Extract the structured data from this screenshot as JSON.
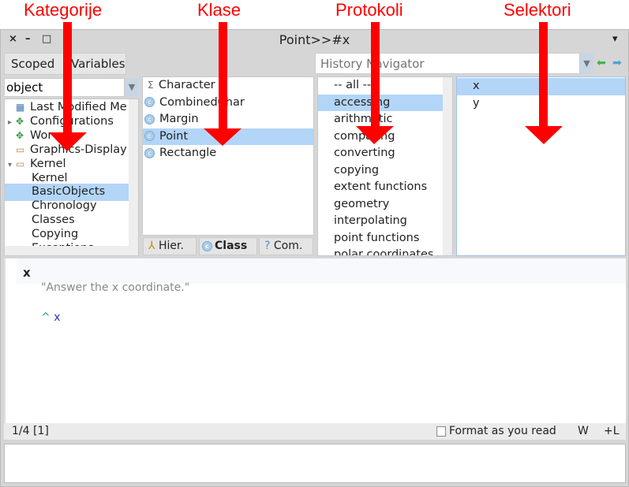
{
  "annotations": [
    "Kategorije",
    "Klase",
    "Protokoli",
    "Selektori"
  ],
  "window": {
    "title": "Point>>#x",
    "close": "×",
    "minimize": "–",
    "maximize": "□",
    "menu": "▾"
  },
  "toolbar": {
    "scoped": "Scoped",
    "variables": "Variables",
    "history_placeholder": "History Navigator"
  },
  "categories": {
    "filter": "object",
    "items": [
      "Last Modified Me",
      "Configurations",
      "Wor",
      "Graphics-Display",
      "Kernel",
      "Kernel",
      "BasicObjects",
      "Chronology",
      "Classes",
      "Copying",
      "Exceptions"
    ],
    "selected": "BasicObjects"
  },
  "classes": {
    "items": [
      "Character",
      "CombinedChar",
      "Margin",
      "Point",
      "Rectangle"
    ],
    "selected": "Point",
    "tabs": [
      "Hier.",
      "Class",
      "Com."
    ]
  },
  "protocols": {
    "items": [
      "-- all --",
      "accessing",
      "arithmetic",
      "comparing",
      "converting",
      "copying",
      "extent functions",
      "geometry",
      "interpolating",
      "point functions",
      "polar coordinates"
    ],
    "selected": "accessing"
  },
  "selectors": {
    "items": [
      "x",
      "y"
    ],
    "selected": "x"
  },
  "code": {
    "selector": "x",
    "comment": "\"Answer the x coordinate.\"",
    "caret": "^",
    "return_var": "x"
  },
  "status": {
    "position": "1/4 [1]",
    "format_label": "Format as you read",
    "w": "W",
    "l": "+L"
  },
  "colors": {
    "selection": "#b3d5f7",
    "annotation": "#ff0000"
  }
}
